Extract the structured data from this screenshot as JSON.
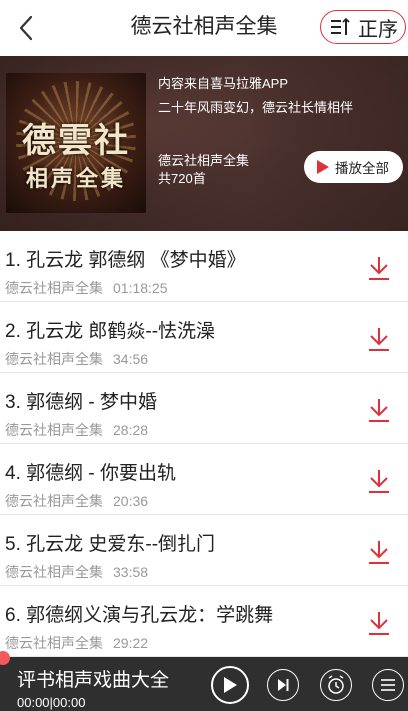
{
  "header": {
    "title": "德云社相声全集",
    "sort_label": "正序",
    "back_icon": "chevron-left-icon",
    "sort_icon": "sort-icon"
  },
  "album": {
    "cover_line1": "德雲社",
    "cover_line2": "相声全集",
    "source": "内容来自喜马拉雅APP",
    "slogan": "二十年风雨变幻，德云社长情相伴",
    "name": "德云社相声全集",
    "count": "共720首",
    "play_all_label": "播放全部"
  },
  "tracks": [
    {
      "title": "1. 孔云龙 郭德纲 《梦中婚》",
      "album": "德云社相声全集",
      "duration": "01:18:25"
    },
    {
      "title": "2. 孔云龙 郎鹤焱--怯洗澡",
      "album": "德云社相声全集",
      "duration": "34:56"
    },
    {
      "title": "3. 郭德纲 - 梦中婚",
      "album": "德云社相声全集",
      "duration": "28:28"
    },
    {
      "title": "4. 郭德纲 - 你要出轨",
      "album": "德云社相声全集",
      "duration": "20:36"
    },
    {
      "title": "5. 孔云龙 史爱东--倒扎门",
      "album": "德云社相声全集",
      "duration": "33:58"
    },
    {
      "title": "6. 郭德纲义演与孔云龙：学跳舞",
      "album": "德云社相声全集",
      "duration": "29:22"
    }
  ],
  "player": {
    "title": "评书相声戏曲大全",
    "time": "00:00|00:00"
  },
  "colors": {
    "accent": "#e0303a",
    "player_bg": "#2f2f2f"
  }
}
